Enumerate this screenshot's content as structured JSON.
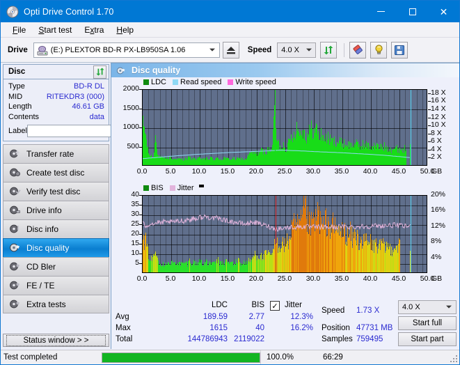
{
  "window": {
    "title": "Opti Drive Control 1.70",
    "icon": "disc-icon",
    "minimize": "minimize-icon",
    "maximize": "maximize-icon",
    "close": "close-icon"
  },
  "menu": [
    {
      "label": "File",
      "accel": "F"
    },
    {
      "label": "Start test",
      "accel": "S"
    },
    {
      "label": "Extra",
      "accel": "x"
    },
    {
      "label": "Help",
      "accel": "H"
    }
  ],
  "toolbar": {
    "drive_label": "Drive",
    "drive_value": "(E:)   PLEXTOR BD-R  PX-LB950SA 1.06",
    "eject_icon": "eject-icon",
    "speed_label": "Speed",
    "speed_value": "4.0 X",
    "refresh_icon": "refresh-icon",
    "eraser_icon": "eraser-icon",
    "bulb_icon": "bulb-icon",
    "save_icon": "save-icon"
  },
  "disc_panel": {
    "title": "Disc",
    "refresh_icon": "refresh-icon",
    "rows": [
      {
        "key": "Type",
        "value": "BD-R DL"
      },
      {
        "key": "MID",
        "value": "RITEKDR3 (000)"
      },
      {
        "key": "Length",
        "value": "46.61 GB"
      },
      {
        "key": "Contents",
        "value": "data"
      }
    ],
    "label_key": "Label",
    "label_value": "",
    "label_placeholder": "",
    "disc_icon": "cd-disc-icon"
  },
  "sidebar": {
    "items": [
      {
        "label": "Transfer rate",
        "icon": "disc-arrow-icon",
        "selected": false
      },
      {
        "label": "Create test disc",
        "icon": "disc-write-icon",
        "selected": false
      },
      {
        "label": "Verify test disc",
        "icon": "disc-check-icon",
        "selected": false
      },
      {
        "label": "Drive info",
        "icon": "disc-info-icon",
        "selected": false
      },
      {
        "label": "Disc info",
        "icon": "disc-info2-icon",
        "selected": false
      },
      {
        "label": "Disc quality",
        "icon": "disc-quality-icon",
        "selected": true
      },
      {
        "label": "CD Bler",
        "icon": "disc-bler-icon",
        "selected": false
      },
      {
        "label": "FE / TE",
        "icon": "disc-fete-icon",
        "selected": false
      },
      {
        "label": "Extra tests",
        "icon": "disc-extra-icon",
        "selected": false
      }
    ],
    "status_window_button": "Status window > >"
  },
  "section": {
    "title": "Disc quality",
    "icon": "disc-quality-icon"
  },
  "stats": {
    "col_ldc": "LDC",
    "col_bis": "BIS",
    "jitter_label": "Jitter",
    "jitter_checked": true,
    "rows": [
      {
        "label": "Avg",
        "ldc": "189.59",
        "bis": "2.77",
        "jitter": "12.3%"
      },
      {
        "label": "Max",
        "ldc": "1615",
        "bis": "40",
        "jitter": "16.2%"
      },
      {
        "label": "Total",
        "ldc": "144786943",
        "bis": "2119022",
        "jitter": ""
      }
    ],
    "speed_label": "Speed",
    "speed_value": "1.73 X",
    "position_label": "Position",
    "position_value": "47731 MB",
    "samples_label": "Samples",
    "samples_value": "759495",
    "speed_select": "4.0 X",
    "start_full": "Start full",
    "start_part": "Start part"
  },
  "statusbar": {
    "message": "Test completed",
    "progress_percent": "100.0%",
    "progress_value": 100,
    "elapsed": "66:29"
  },
  "colors": {
    "accent": "#0078d4",
    "ldc_green": "#18dc18",
    "read_speed": "#8fd9f5",
    "write_speed": "#ff69dc",
    "jitter_pink": "#e2b4dc",
    "bis_green": "#18dc18",
    "plot_bg": "#606f8c",
    "value_blue": "#2a2ad0",
    "progress_green": "#12b521"
  },
  "chart_data": [
    {
      "type": "area",
      "name": "disc-quality-ldc-chart",
      "title": "",
      "xlabel": "GB",
      "x_ticks": [
        "0.0",
        "5.0",
        "10.0",
        "15.0",
        "20.0",
        "25.0",
        "30.0",
        "35.0",
        "40.0",
        "45.0",
        "50.0"
      ],
      "xlim": [
        0,
        50
      ],
      "ylabel_left": "LDC",
      "y_ticks_left": [
        "500",
        "1000",
        "1500",
        "2000"
      ],
      "ylim_left": [
        0,
        2000
      ],
      "ylabel_right": "X",
      "y_ticks_right": [
        "2 X",
        "4 X",
        "6 X",
        "8 X",
        "10 X",
        "12 X",
        "14 X",
        "16 X",
        "18 X"
      ],
      "ylim_right": [
        0,
        19
      ],
      "legend": [
        {
          "label": "LDC",
          "color": "#0f8a0f"
        },
        {
          "label": "Read speed",
          "color": "#8fd9f5"
        },
        {
          "label": "Write speed",
          "color": "#ff69dc"
        }
      ],
      "legend_position": "top-left",
      "grid": true,
      "markers": [
        {
          "type": "vline",
          "x": 23.2,
          "color": "#18dc18",
          "label": "ldc-spike-marker"
        },
        {
          "type": "vline",
          "x": 46.9,
          "color": "#5ad6f5",
          "label": "end-of-data-marker"
        }
      ],
      "series": [
        {
          "name": "LDC",
          "color": "#18dc18",
          "x": [
            0.0,
            0.3,
            0.6,
            0.9,
            1.2,
            1.6,
            1.9,
            2.2,
            2.5,
            2.9,
            3.2,
            3.5,
            3.8,
            4.2,
            4.5,
            4.8,
            5.1,
            5.5,
            5.8,
            6.1,
            6.4,
            6.8,
            7.1,
            7.4,
            7.7,
            8.1,
            8.4,
            8.7,
            9.0,
            9.4,
            9.7,
            10.0,
            10.3,
            10.7,
            11.0,
            11.3,
            11.6,
            12.0,
            12.3,
            12.6,
            12.9,
            13.3,
            13.6,
            13.9,
            14.2,
            14.6,
            14.9,
            15.2,
            15.5,
            15.9,
            16.2,
            16.5,
            16.8,
            17.2,
            17.5,
            17.8,
            18.1,
            18.5,
            18.8,
            19.1,
            19.4,
            19.8,
            20.1,
            20.4,
            20.7,
            21.1,
            21.4,
            21.7,
            22.0,
            22.4,
            22.7,
            23.0,
            23.2,
            23.4,
            23.7,
            24.0,
            24.3,
            24.7,
            25.0,
            25.3,
            25.6,
            26.0,
            26.3,
            26.6,
            26.9,
            27.3,
            27.6,
            27.9,
            28.2,
            28.6,
            28.9,
            29.2,
            29.5,
            29.9,
            30.2,
            30.5,
            30.8,
            31.2,
            31.5,
            31.8,
            32.1,
            32.5,
            32.8,
            33.1,
            33.4,
            33.8,
            34.1,
            34.4,
            34.7,
            35.1,
            35.4,
            35.7,
            36.0,
            36.4,
            36.7,
            37.0,
            37.3,
            37.7,
            38.0,
            38.3,
            38.6,
            39.0,
            39.3,
            39.6,
            39.9,
            40.3,
            40.6,
            40.9,
            41.2,
            41.6,
            41.9,
            42.2,
            42.5,
            42.9,
            43.2,
            43.5,
            43.8,
            44.2,
            44.5,
            44.8,
            45.1,
            45.5,
            45.8,
            46.1,
            46.4,
            46.8
          ],
          "values": [
            1000,
            920,
            620,
            330,
            250,
            210,
            200,
            990,
            260,
            200,
            180,
            170,
            160,
            200,
            150,
            230,
            140,
            150,
            180,
            140,
            160,
            140,
            150,
            170,
            140,
            200,
            150,
            140,
            160,
            150,
            190,
            150,
            140,
            170,
            150,
            160,
            150,
            180,
            150,
            140,
            160,
            170,
            150,
            140,
            190,
            150,
            160,
            150,
            140,
            180,
            150,
            160,
            150,
            170,
            150,
            140,
            160,
            260,
            300,
            290,
            320,
            300,
            310,
            330,
            360,
            320,
            340,
            360,
            380,
            420,
            400,
            1610,
            900,
            620,
            560,
            420,
            470,
            520,
            440,
            470,
            560,
            700,
            760,
            820,
            950,
            880,
            760,
            930,
            820,
            700,
            780,
            860,
            900,
            860,
            820,
            960,
            700,
            760,
            720,
            680,
            640,
            700,
            620,
            600,
            580,
            620,
            560,
            600,
            540,
            560,
            520,
            540,
            500,
            520,
            480,
            560,
            500,
            520,
            470,
            490,
            520,
            460,
            500,
            470,
            450,
            480,
            460,
            500,
            440,
            460,
            430,
            450,
            470,
            420,
            440,
            410,
            430,
            400,
            420,
            390,
            410,
            380,
            400,
            430
          ]
        },
        {
          "name": "Read speed",
          "color": "#8fd9f5",
          "x": [
            0.0,
            2.5,
            5.0,
            7.5,
            10.0,
            12.5,
            15.0,
            17.5,
            20.0,
            22.5,
            23.5,
            25.0,
            26.0,
            28.0,
            30.0,
            32.5,
            35.0,
            37.5,
            40.0,
            42.5,
            45.0,
            46.8
          ],
          "values": [
            1.95,
            2.25,
            2.55,
            2.8,
            3.05,
            3.25,
            3.45,
            3.6,
            3.75,
            3.9,
            4.0,
            4.0,
            3.95,
            3.85,
            3.7,
            3.55,
            3.4,
            3.2,
            3.0,
            2.75,
            2.45,
            2.2
          ],
          "unit": "X"
        }
      ]
    },
    {
      "type": "area",
      "name": "disc-quality-bis-jitter-chart",
      "title": "",
      "xlabel": "GB",
      "x_ticks": [
        "0.0",
        "5.0",
        "10.0",
        "15.0",
        "20.0",
        "25.0",
        "30.0",
        "35.0",
        "40.0",
        "45.0",
        "50.0"
      ],
      "xlim": [
        0,
        50
      ],
      "ylabel_left": "BIS",
      "y_ticks_left": [
        "5",
        "10",
        "15",
        "20",
        "25",
        "30",
        "35",
        "40"
      ],
      "ylim_left": [
        0,
        40
      ],
      "ylabel_right": "Jitter",
      "y_ticks_right": [
        "4%",
        "8%",
        "12%",
        "16%",
        "20%"
      ],
      "ylim_right": [
        0,
        20
      ],
      "legend": [
        {
          "label": "BIS",
          "color": "#0f8a0f"
        },
        {
          "label": "Jitter",
          "color": "#e2b4dc"
        }
      ],
      "legend_position": "top-left",
      "grid": true,
      "markers": [
        {
          "type": "vline",
          "x": 23.3,
          "color": "#d01414",
          "label": "bis-threshold-marker"
        },
        {
          "type": "vline",
          "x": 46.9,
          "color": "#5ad6f5",
          "label": "end-of-data-marker"
        }
      ],
      "series": [
        {
          "name": "BIS",
          "color": "#18dc18",
          "x": [
            0.0,
            0.4,
            0.8,
            1.2,
            1.6,
            2.0,
            2.4,
            2.9,
            3.3,
            3.7,
            4.1,
            4.5,
            4.9,
            5.3,
            5.7,
            6.1,
            6.5,
            7.0,
            7.4,
            7.8,
            8.2,
            8.6,
            9.0,
            9.4,
            9.8,
            10.2,
            10.6,
            11.0,
            11.5,
            11.9,
            12.3,
            12.7,
            13.1,
            13.5,
            13.9,
            14.3,
            14.7,
            15.1,
            15.6,
            16.0,
            16.4,
            16.8,
            17.2,
            17.6,
            18.0,
            18.4,
            18.8,
            19.2,
            19.7,
            20.1,
            20.5,
            20.9,
            21.3,
            21.7,
            22.1,
            22.5,
            22.9,
            23.3,
            23.5,
            23.9,
            24.3,
            24.7,
            25.1,
            25.5,
            25.9,
            26.3,
            26.7,
            27.1,
            27.5,
            27.9,
            28.3,
            28.7,
            29.1,
            29.5,
            29.9,
            30.3,
            30.7,
            31.1,
            31.5,
            31.9,
            32.3,
            32.7,
            33.1,
            33.5,
            33.9,
            34.3,
            34.7,
            35.1,
            35.5,
            35.9,
            36.3,
            36.7,
            37.1,
            37.5,
            37.9,
            38.3,
            38.7,
            39.1,
            39.5,
            39.9,
            40.3,
            40.7,
            41.1,
            41.5,
            41.9,
            42.3,
            42.7,
            43.1,
            43.5,
            43.9,
            44.3,
            44.7,
            45.1,
            45.5,
            45.9,
            46.3,
            46.8
          ],
          "values": [
            14,
            16,
            10,
            7,
            6,
            9,
            12,
            4,
            4,
            4,
            5,
            4,
            4,
            5,
            4,
            5,
            4,
            4,
            5,
            4,
            6,
            4,
            5,
            4,
            5,
            6,
            4,
            5,
            4,
            5,
            4,
            5,
            6,
            4,
            5,
            4,
            6,
            4,
            5,
            4,
            5,
            6,
            4,
            5,
            4,
            6,
            5,
            7,
            9,
            8,
            8,
            7,
            8,
            9,
            8,
            9,
            10,
            17,
            14,
            13,
            15,
            13,
            14,
            15,
            19,
            23,
            20,
            24,
            21,
            25,
            33,
            27,
            23,
            22,
            26,
            24,
            30,
            25,
            21,
            23,
            26,
            21,
            24,
            20,
            22,
            19,
            21,
            18,
            20,
            17,
            19,
            16,
            18,
            17,
            15,
            16,
            14,
            16,
            13,
            15,
            12,
            14,
            13,
            12,
            14,
            11,
            13,
            12,
            11,
            13,
            12,
            14,
            12
          ]
        },
        {
          "name": "Jitter",
          "color": "#e2b4dc",
          "x": [
            0.0,
            0.5,
            1.0,
            1.6,
            2.1,
            2.6,
            3.1,
            3.7,
            4.2,
            4.7,
            5.2,
            5.8,
            6.3,
            6.8,
            7.3,
            7.9,
            8.4,
            8.9,
            9.4,
            10.0,
            10.5,
            11.0,
            11.5,
            12.1,
            12.6,
            13.1,
            13.6,
            14.2,
            14.7,
            15.2,
            15.7,
            16.3,
            16.8,
            17.3,
            17.8,
            18.4,
            18.9,
            19.4,
            19.9,
            20.5,
            21.0,
            21.5,
            22.0,
            22.6,
            23.1,
            23.6,
            24.1,
            24.7,
            25.2,
            25.7,
            26.2,
            26.8,
            27.3,
            27.8,
            28.3,
            28.9,
            29.4,
            29.9,
            30.4,
            31.0,
            31.5,
            32.0,
            32.5,
            33.1,
            33.6,
            34.1,
            34.6,
            35.2,
            35.7,
            36.2,
            36.7,
            37.3,
            37.8,
            38.3,
            38.8,
            39.4,
            39.9,
            40.4,
            40.9,
            41.5,
            42.0,
            42.5,
            43.0,
            43.6,
            44.1,
            44.6,
            45.1,
            45.7,
            46.2,
            46.8
          ],
          "values": [
            25.8,
            24.6,
            25.2,
            26.0,
            25.4,
            26.4,
            25.8,
            26.6,
            26.0,
            26.8,
            26.2,
            27.0,
            26.6,
            27.4,
            27.0,
            28.2,
            27.4,
            28.6,
            28.0,
            29.2,
            28.4,
            29.6,
            28.8,
            29.0,
            28.2,
            28.6,
            27.8,
            28.0,
            27.0,
            27.2,
            26.4,
            26.6,
            25.8,
            26.0,
            25.4,
            25.8,
            26.2,
            26.6,
            26.0,
            25.6,
            25.2,
            24.8,
            24.4,
            23.6,
            23.2,
            23.0,
            23.4,
            23.2,
            23.8,
            23.6,
            24.0,
            23.8,
            24.2,
            24.0,
            24.2,
            24.0,
            23.8,
            24.0,
            23.8,
            24.0,
            23.8,
            24.0,
            23.8,
            24.0,
            23.8,
            24.0,
            24.2,
            24.0,
            24.2,
            24.0,
            24.2,
            24.0,
            24.2,
            24.4,
            24.2,
            24.4,
            24.2,
            24.4,
            24.6,
            24.4,
            24.6,
            24.8,
            24.6,
            24.8,
            25.0,
            24.8,
            24.6,
            24.4,
            24.2,
            24.4
          ],
          "unit": "%"
        }
      ]
    }
  ]
}
